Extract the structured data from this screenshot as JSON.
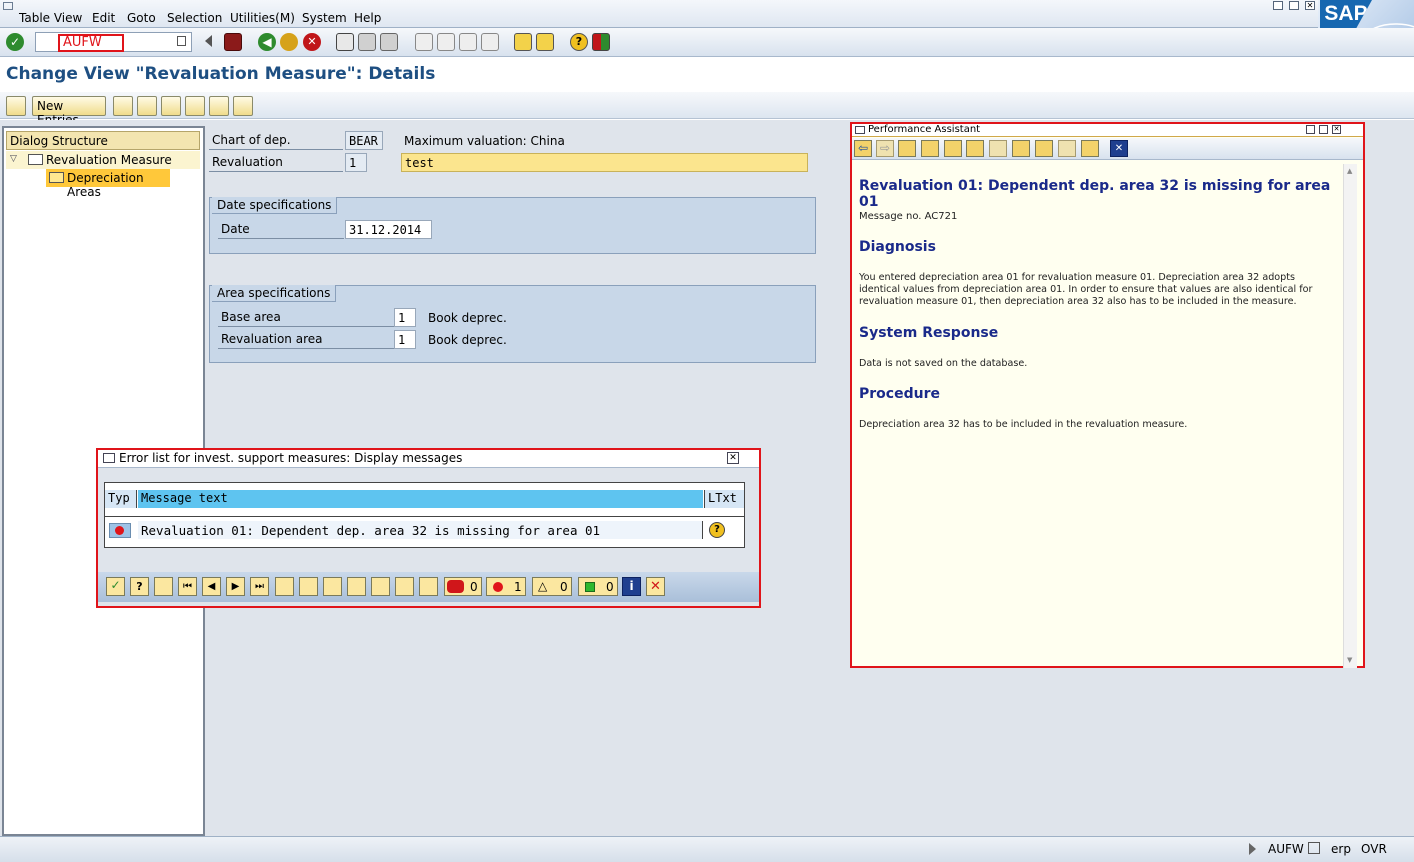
{
  "menu": [
    "Table View",
    "Edit",
    "Goto",
    "Selection",
    "Utilities(M)",
    "System",
    "Help"
  ],
  "command_field": {
    "value": "AUFW"
  },
  "title": "Change View \"Revaluation Measure\": Details",
  "app_toolbar": {
    "new_entries": "New Entries"
  },
  "tree": {
    "header": "Dialog Structure",
    "items": [
      {
        "label": "Revaluation Measure"
      },
      {
        "label": "Depreciation Areas"
      }
    ]
  },
  "form": {
    "chart_label": "Chart of dep.",
    "chart_value": "BEAR",
    "chart_desc": "Maximum valuation: China",
    "reval_label": "Revaluation",
    "reval_value": "1",
    "reval_desc": "test",
    "date_group": "Date specifications",
    "date_label": "Date",
    "date_value": "31.12.2014",
    "area_group": "Area specifications",
    "base_label": "Base area",
    "base_value": "1",
    "base_desc": "Book deprec.",
    "reval_area_label": "Revaluation area",
    "reval_area_value": "1",
    "reval_area_desc": "Book deprec."
  },
  "error_dialog": {
    "title": "Error list for invest. support measures: Display messages",
    "col_typ": "Typ",
    "col_msg": "Message text",
    "col_ltxt": "LTxt",
    "row_text": "Revaluation 01: Dependent dep. area 32 is missing for area 01",
    "count_stop": "0",
    "count_error": "1",
    "count_warning": "0",
    "count_success": "0"
  },
  "perf_assistant": {
    "title": "Performance Assistant",
    "heading": "Revaluation 01: Dependent dep. area 32 is missing for area 01",
    "msg_no": "Message no. AC721",
    "diag_h": "Diagnosis",
    "diag_text": "You entered depreciation area 01 for revaluation measure 01. Depreciation area 32 adopts identical values from depreciation area 01. In order to ensure that values are also identical for revaluation measure 01, then depreciation area 32 also has to be included in the measure.",
    "resp_h": "System Response",
    "resp_text": "Data is not saved on the database.",
    "proc_h": "Procedure",
    "proc_text": "Depreciation area 32 has to be included in the revaluation measure."
  },
  "statusbar": {
    "tcode": "AUFW",
    "system": "erp",
    "mode": "OVR"
  },
  "colors": {
    "accent": "#1e4f82",
    "highlight": "#ffe680",
    "error_red": "#e0141a"
  },
  "brand": "SAP"
}
